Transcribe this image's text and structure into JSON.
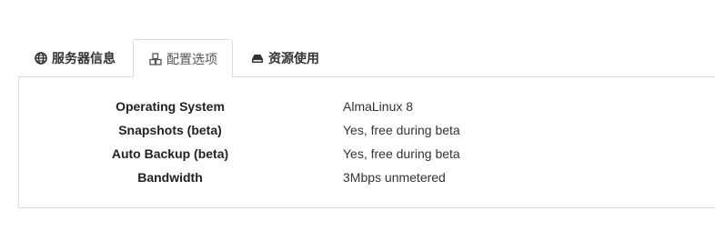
{
  "tabs": [
    {
      "label": "服务器信息",
      "icon": "globe-icon",
      "active": false
    },
    {
      "label": "配置选项",
      "icon": "cubes-icon",
      "active": true
    },
    {
      "label": "资源使用",
      "icon": "drive-icon",
      "active": false
    }
  ],
  "config": [
    {
      "label": "Operating System",
      "value": "AlmaLinux 8"
    },
    {
      "label": "Snapshots (beta)",
      "value": "Yes, free during beta"
    },
    {
      "label": "Auto Backup (beta)",
      "value": "Yes, free during beta"
    },
    {
      "label": "Bandwidth",
      "value": "3Mbps unmetered"
    }
  ],
  "colors": {
    "border": "#dddddd",
    "text": "#333333"
  }
}
